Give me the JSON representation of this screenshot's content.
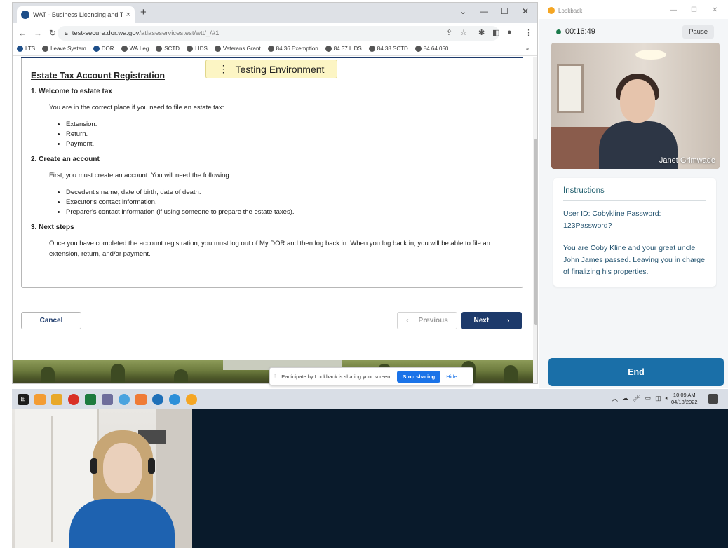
{
  "browser": {
    "tab_title": "WAT - Business Licensing and Tax",
    "tab_close": "×",
    "new_tab": "+",
    "win_controls": [
      "⌄",
      "—",
      "☐",
      "✕"
    ],
    "url_host": "test-secure.dor.wa.gov",
    "url_path": "/atlaseservicestest/wtt/_/#1",
    "bookmarks": [
      "LTS",
      "Leave System",
      "DOR",
      "WA Leg",
      "SCTD",
      "LIDS",
      "Veterans Grant",
      "84.36 Exemption",
      "84.37 LIDS",
      "84.38 SCTD",
      "84.64.050"
    ],
    "bookmarks_more": "»"
  },
  "page": {
    "testing_banner": "Testing Environment",
    "title": "Estate Tax Account Registration",
    "s1_heading": "1. Welcome to estate tax",
    "s1_text": "You are in the correct place if you need to file an estate tax:",
    "s1_items": [
      "Extension.",
      "Return.",
      "Payment."
    ],
    "s2_heading": "2. Create an account",
    "s2_text": "First, you must create an account. You will need the following:",
    "s2_items": [
      "Decedent's name, date of birth, date of death.",
      "Executor's contact information.",
      "Preparer's contact information (if using someone to prepare the estate taxes)."
    ],
    "s3_heading": "3. Next steps",
    "s3_text": "Once you have completed the account registration, you must log out of My DOR and then log back in. When you log back in, you will be able to file an extension, return, and/or payment.",
    "cancel": "Cancel",
    "previous": "Previous",
    "next": "Next"
  },
  "share_bar": {
    "text": "Participate by Lookback is sharing your screen.",
    "stop": "Stop sharing",
    "hide": "Hide"
  },
  "lookback": {
    "app_name": "Lookback",
    "timer": "00:16:49",
    "pause": "Pause",
    "participant_name": "Janet Grimwade",
    "instructions_title": "Instructions",
    "instr_line1": "User ID: Cobykline Password: 123Password?",
    "instr_line2": "You are Coby Kline and your great uncle John James passed. Leaving you in charge of finalizing his properties.",
    "end": "End"
  },
  "taskbar": {
    "time": "10:09 AM",
    "date": "04/18/2022"
  },
  "colors": {
    "accent_navy": "#1d3a6b",
    "lookback_teal": "#1d5c6b",
    "end_button": "#1a6fa8",
    "testing_banner": "#fcf5c4"
  }
}
